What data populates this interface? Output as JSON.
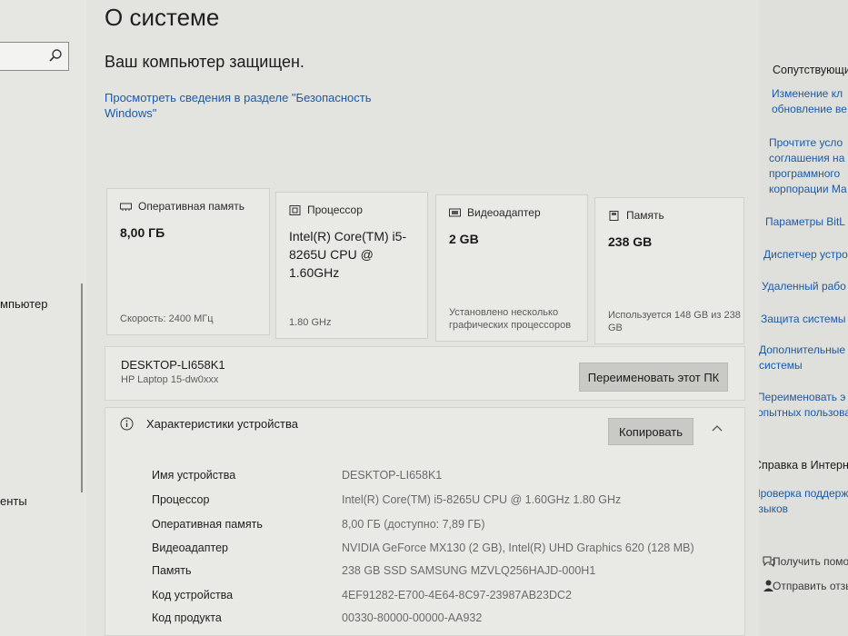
{
  "sidebar": {
    "items": [
      {
        "label": "мпьютер"
      },
      {
        "label": "енты"
      }
    ]
  },
  "page": {
    "title": "О системе",
    "protected_text": "Ваш компьютер защищен.",
    "security_link": "Просмотреть сведения в разделе \"Безопасность Windows\""
  },
  "cards": [
    {
      "icon": "memory-icon",
      "label": "Оперативная память",
      "value": "8,00 ГБ",
      "sub": "Скорость: 2400 МГц"
    },
    {
      "icon": "cpu-icon",
      "label": "Процессор",
      "value": "Intel(R) Core(TM) i5-8265U CPU @ 1.60GHz",
      "sub": "1.80 GHz"
    },
    {
      "icon": "gpu-icon",
      "label": "Видеоадаптер",
      "value": "2 GB",
      "sub": "Установлено несколько графических процессоров"
    },
    {
      "icon": "storage-icon",
      "label": "Память",
      "value": "238 GB",
      "sub": "Используется 148 GB из 238 GB"
    }
  ],
  "device": {
    "name": "DESKTOP-LI658K1",
    "model": "HP Laptop 15-dw0xxx",
    "rename_label": "Переименовать этот ПК"
  },
  "specs": {
    "title": "Характеристики устройства",
    "copy_label": "Копировать",
    "rows": [
      {
        "key": "Имя устройства",
        "value": "DESKTOP-LI658K1"
      },
      {
        "key": "Процессор",
        "value": "Intel(R) Core(TM) i5-8265U CPU @ 1.60GHz   1.80 GHz"
      },
      {
        "key": "Оперативная память",
        "value": "8,00 ГБ (доступно: 7,89 ГБ)"
      },
      {
        "key": "Видеоадаптер",
        "value": "NVIDIA GeForce MX130 (2 GB), Intel(R) UHD Graphics 620 (128 MB)"
      },
      {
        "key": "Память",
        "value": "238 GB SSD SAMSUNG MZVLQ256HAJD-000H1"
      },
      {
        "key": "Код устройства",
        "value": "4EF91282-E700-4E64-8C97-23987AB23DC2"
      },
      {
        "key": "Код продукта",
        "value": "00330-80000-00000-AA932"
      }
    ]
  },
  "related": {
    "heading": "Сопутствующи",
    "links": [
      {
        "text": "Изменение кл\nобновление ве"
      },
      {
        "text": "Прочтите усло\nсоглашения на\nпрограммного\nкорпорации Ма"
      },
      {
        "text": "Параметры BitL"
      },
      {
        "text": "Диспетчер устро"
      },
      {
        "text": "Удаленный рабо"
      },
      {
        "text": "Защита системы"
      },
      {
        "text": "Дополнительные\nсистемы"
      },
      {
        "text": "Переименовать э\nопытных пользова"
      }
    ],
    "help_heading": "Справка в Интерне",
    "help_link": "Проверка поддерж\nязыков",
    "actions": [
      {
        "icon": "help-icon",
        "text": "Получить помо"
      },
      {
        "icon": "feedback-icon",
        "text": "Отправить отзы"
      }
    ]
  },
  "colors": {
    "accent_link": "#1b5aa8",
    "background": "#e3e4df"
  }
}
